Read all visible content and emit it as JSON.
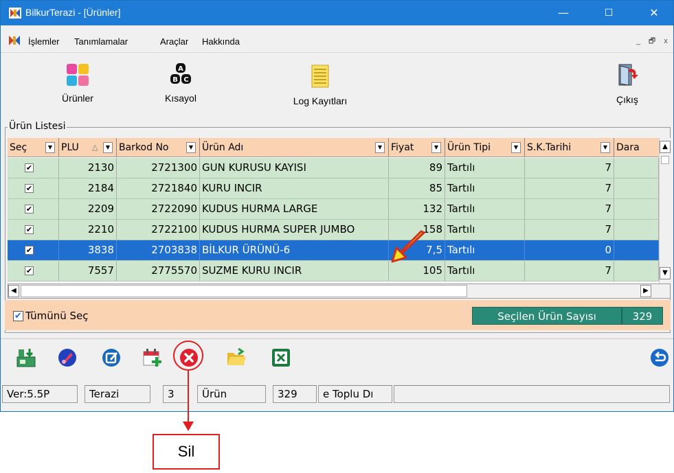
{
  "window": {
    "title": "BilkurTerazi  - [Ürünler]",
    "controls": {
      "minimize": "—",
      "maximize": "☐",
      "close": "✕"
    }
  },
  "menu": {
    "items": [
      "İşlemler",
      "Tanımlamalar",
      "Araçlar",
      "Hakkında"
    ],
    "mdi_controls": [
      "_",
      "🗗",
      "x"
    ]
  },
  "toolbar": {
    "buttons": [
      {
        "label": "Ürünler",
        "icon": "products-icon"
      },
      {
        "label": "Kısayol",
        "icon": "abc-shortcut-icon"
      },
      {
        "label": "Log Kayıtları",
        "icon": "log-notepad-icon"
      },
      {
        "label": "Çıkış",
        "icon": "exit-door-icon"
      }
    ]
  },
  "list": {
    "group_title": "Ürün Listesi",
    "columns": [
      "Seç",
      "PLU",
      "Barkod No",
      "Ürün Adı",
      "Fiyat",
      "Ürün Tipi",
      "S.K.Tarihi",
      "Dara"
    ],
    "rows": [
      {
        "checked": true,
        "plu": "2130",
        "barcode": "2721300",
        "name": "GUN KURUSU KAYISI",
        "price": "89",
        "type": "Tartılı",
        "sk": "7",
        "selected": false
      },
      {
        "checked": true,
        "plu": "2184",
        "barcode": "2721840",
        "name": "KURU INCIR",
        "price": "85",
        "type": "Tartılı",
        "sk": "7",
        "selected": false
      },
      {
        "checked": true,
        "plu": "2209",
        "barcode": "2722090",
        "name": "KUDUS HURMA LARGE",
        "price": "132",
        "type": "Tartılı",
        "sk": "7",
        "selected": false
      },
      {
        "checked": true,
        "plu": "2210",
        "barcode": "2722100",
        "name": "KUDUS HURMA SUPER JUMBO",
        "price": "158",
        "type": "Tartılı",
        "sk": "7",
        "selected": false
      },
      {
        "checked": true,
        "plu": "3838",
        "barcode": "2703838",
        "name": "BİLKUR ÜRÜNÜ-6",
        "price": "7,5",
        "type": "Tartılı",
        "sk": "0",
        "selected": true
      },
      {
        "checked": true,
        "plu": "7557",
        "barcode": "2775570",
        "name": "SUZME KURU INCIR",
        "price": "105",
        "type": "Tartılı",
        "sk": "7",
        "selected": false
      }
    ]
  },
  "bottom": {
    "select_all_label": "Tümünü Seç",
    "selected_count_label": "Seçilen Ürün Sayısı",
    "selected_count": "329"
  },
  "actions": {
    "icons": [
      "scale-upload-icon",
      "paint-brush-icon",
      "edit-icon",
      "calendar-add-icon",
      "delete-icon",
      "open-folder-icon",
      "excel-export-icon",
      "back-icon"
    ]
  },
  "status": {
    "version": "Ver:5.5P",
    "scale_label": "Terazi",
    "scale_count": "3",
    "product_label": "Ürün",
    "product_count": "329",
    "bulk": "e Toplu Dı"
  },
  "annotation": {
    "label": "Sil",
    "color": "#e02020"
  }
}
